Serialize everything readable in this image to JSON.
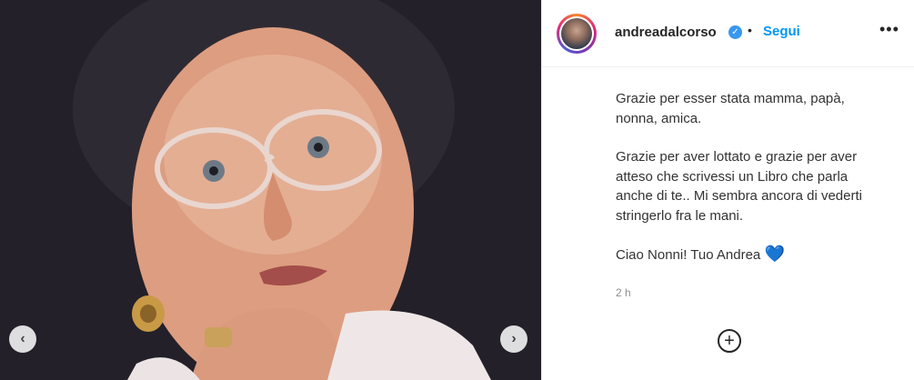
{
  "post": {
    "image_alt": "Foto di una donna anziana con occhiali",
    "prev_icon": "chevron-left-icon",
    "next_icon": "chevron-right-icon"
  },
  "header": {
    "username": "andreadalcorso",
    "verified_icon": "verified-badge-icon",
    "separator": "•",
    "follow_label": "Segui",
    "more_label": "•••"
  },
  "caption": {
    "p1": "Grazie per esser stata mamma, papà, nonna, amica.",
    "p2": "Grazie per aver lottato e grazie per aver atteso che scrivessi un Libro che parla anche di te.. Mi sembra ancora di vederti stringerlo fra le mani.",
    "p3": "Ciao Nonni! Tuo Andrea",
    "heart": "💙"
  },
  "timestamp": "2 h",
  "add_label": "+",
  "colors": {
    "accent": "#0095f6",
    "verified": "#3897f0",
    "heart": "#1b6fd8",
    "muted": "#8e8e8e"
  }
}
